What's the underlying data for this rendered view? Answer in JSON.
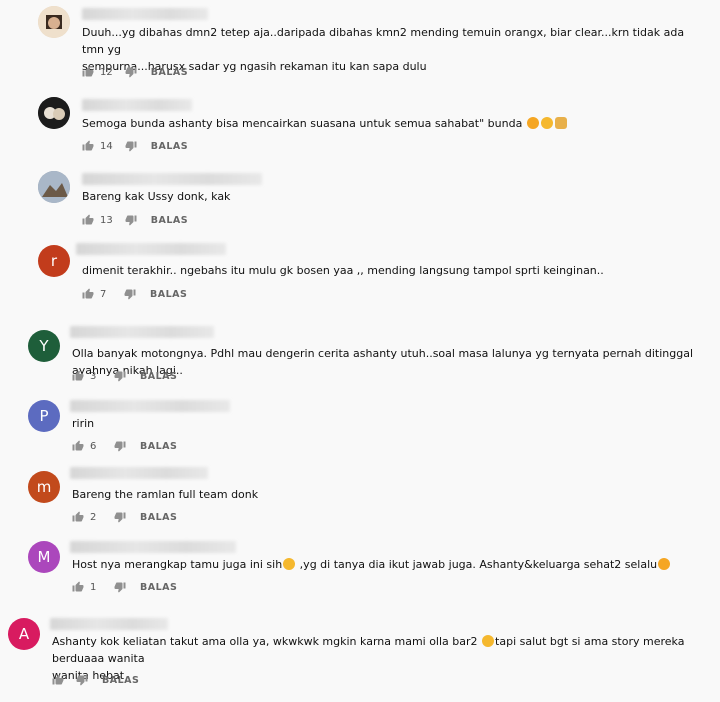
{
  "comments": [
    {
      "avatar_letter": "",
      "avatar_color": "#c9a27a",
      "text": "Duuh...yg dibahas dmn2 tetep aja..daripada dibahas kmn2 mending temuin orangx, biar clear...krn tidak ada tmn yg\nsempurna...harusx sadar yg ngasih rekaman itu kan sapa dulu",
      "likes": "12",
      "reply": "BALAS"
    },
    {
      "avatar_letter": "",
      "avatar_color": "#222222",
      "text": "Semoga bunda ashanty bisa mencairkan suasana untuk semua sahabat\" bunda",
      "likes": "14",
      "reply": "BALAS",
      "emojis": [
        "😍",
        "😊",
        "🙏"
      ]
    },
    {
      "avatar_letter": "",
      "avatar_color": "#7e8a9a",
      "text": "Bareng kak Ussy donk, kak",
      "likes": "13",
      "reply": "BALAS"
    },
    {
      "avatar_letter": "r",
      "avatar_color": "#c23c1c",
      "text": "dimenit terakhir.. ngebahs itu mulu gk bosen yaa ,, mending langsung tampol sprti keinginan..",
      "likes": "7",
      "reply": "BALAS"
    },
    {
      "avatar_letter": "Y",
      "avatar_color": "#1e5e3a",
      "text": "Olla banyak motongnya. Pdhl mau dengerin cerita ashanty utuh..soal masa lalunya yg ternyata pernah ditinggal ayahnya nikah lagi..",
      "likes": "3",
      "reply": "BALAS"
    },
    {
      "avatar_letter": "P",
      "avatar_color": "#5c6bc0",
      "text": "ririn",
      "likes": "6",
      "reply": "BALAS"
    },
    {
      "avatar_letter": "m",
      "avatar_color": "#c24a1c",
      "text": "Bareng the ramlan full team donk",
      "likes": "2",
      "reply": "BALAS"
    },
    {
      "avatar_letter": "M",
      "avatar_color": "#ab47bc",
      "text": "Host nya merangkap tamu juga ini sih",
      "text2": " ,yg di tanya dia ikut jawab juga. Ashanty&keluarga sehat2 selalu",
      "likes": "1",
      "reply": "BALAS"
    },
    {
      "avatar_letter": "A",
      "avatar_color": "#d81b60",
      "text": "Ashanty kok keliatan takut ama olla ya, wkwkwk mgkin karna mami olla bar2 ",
      "text2": "tapi salut bgt si ama story mereka berduaaa wanita\nwanita hebat",
      "likes": "",
      "reply": "BALAS"
    }
  ]
}
